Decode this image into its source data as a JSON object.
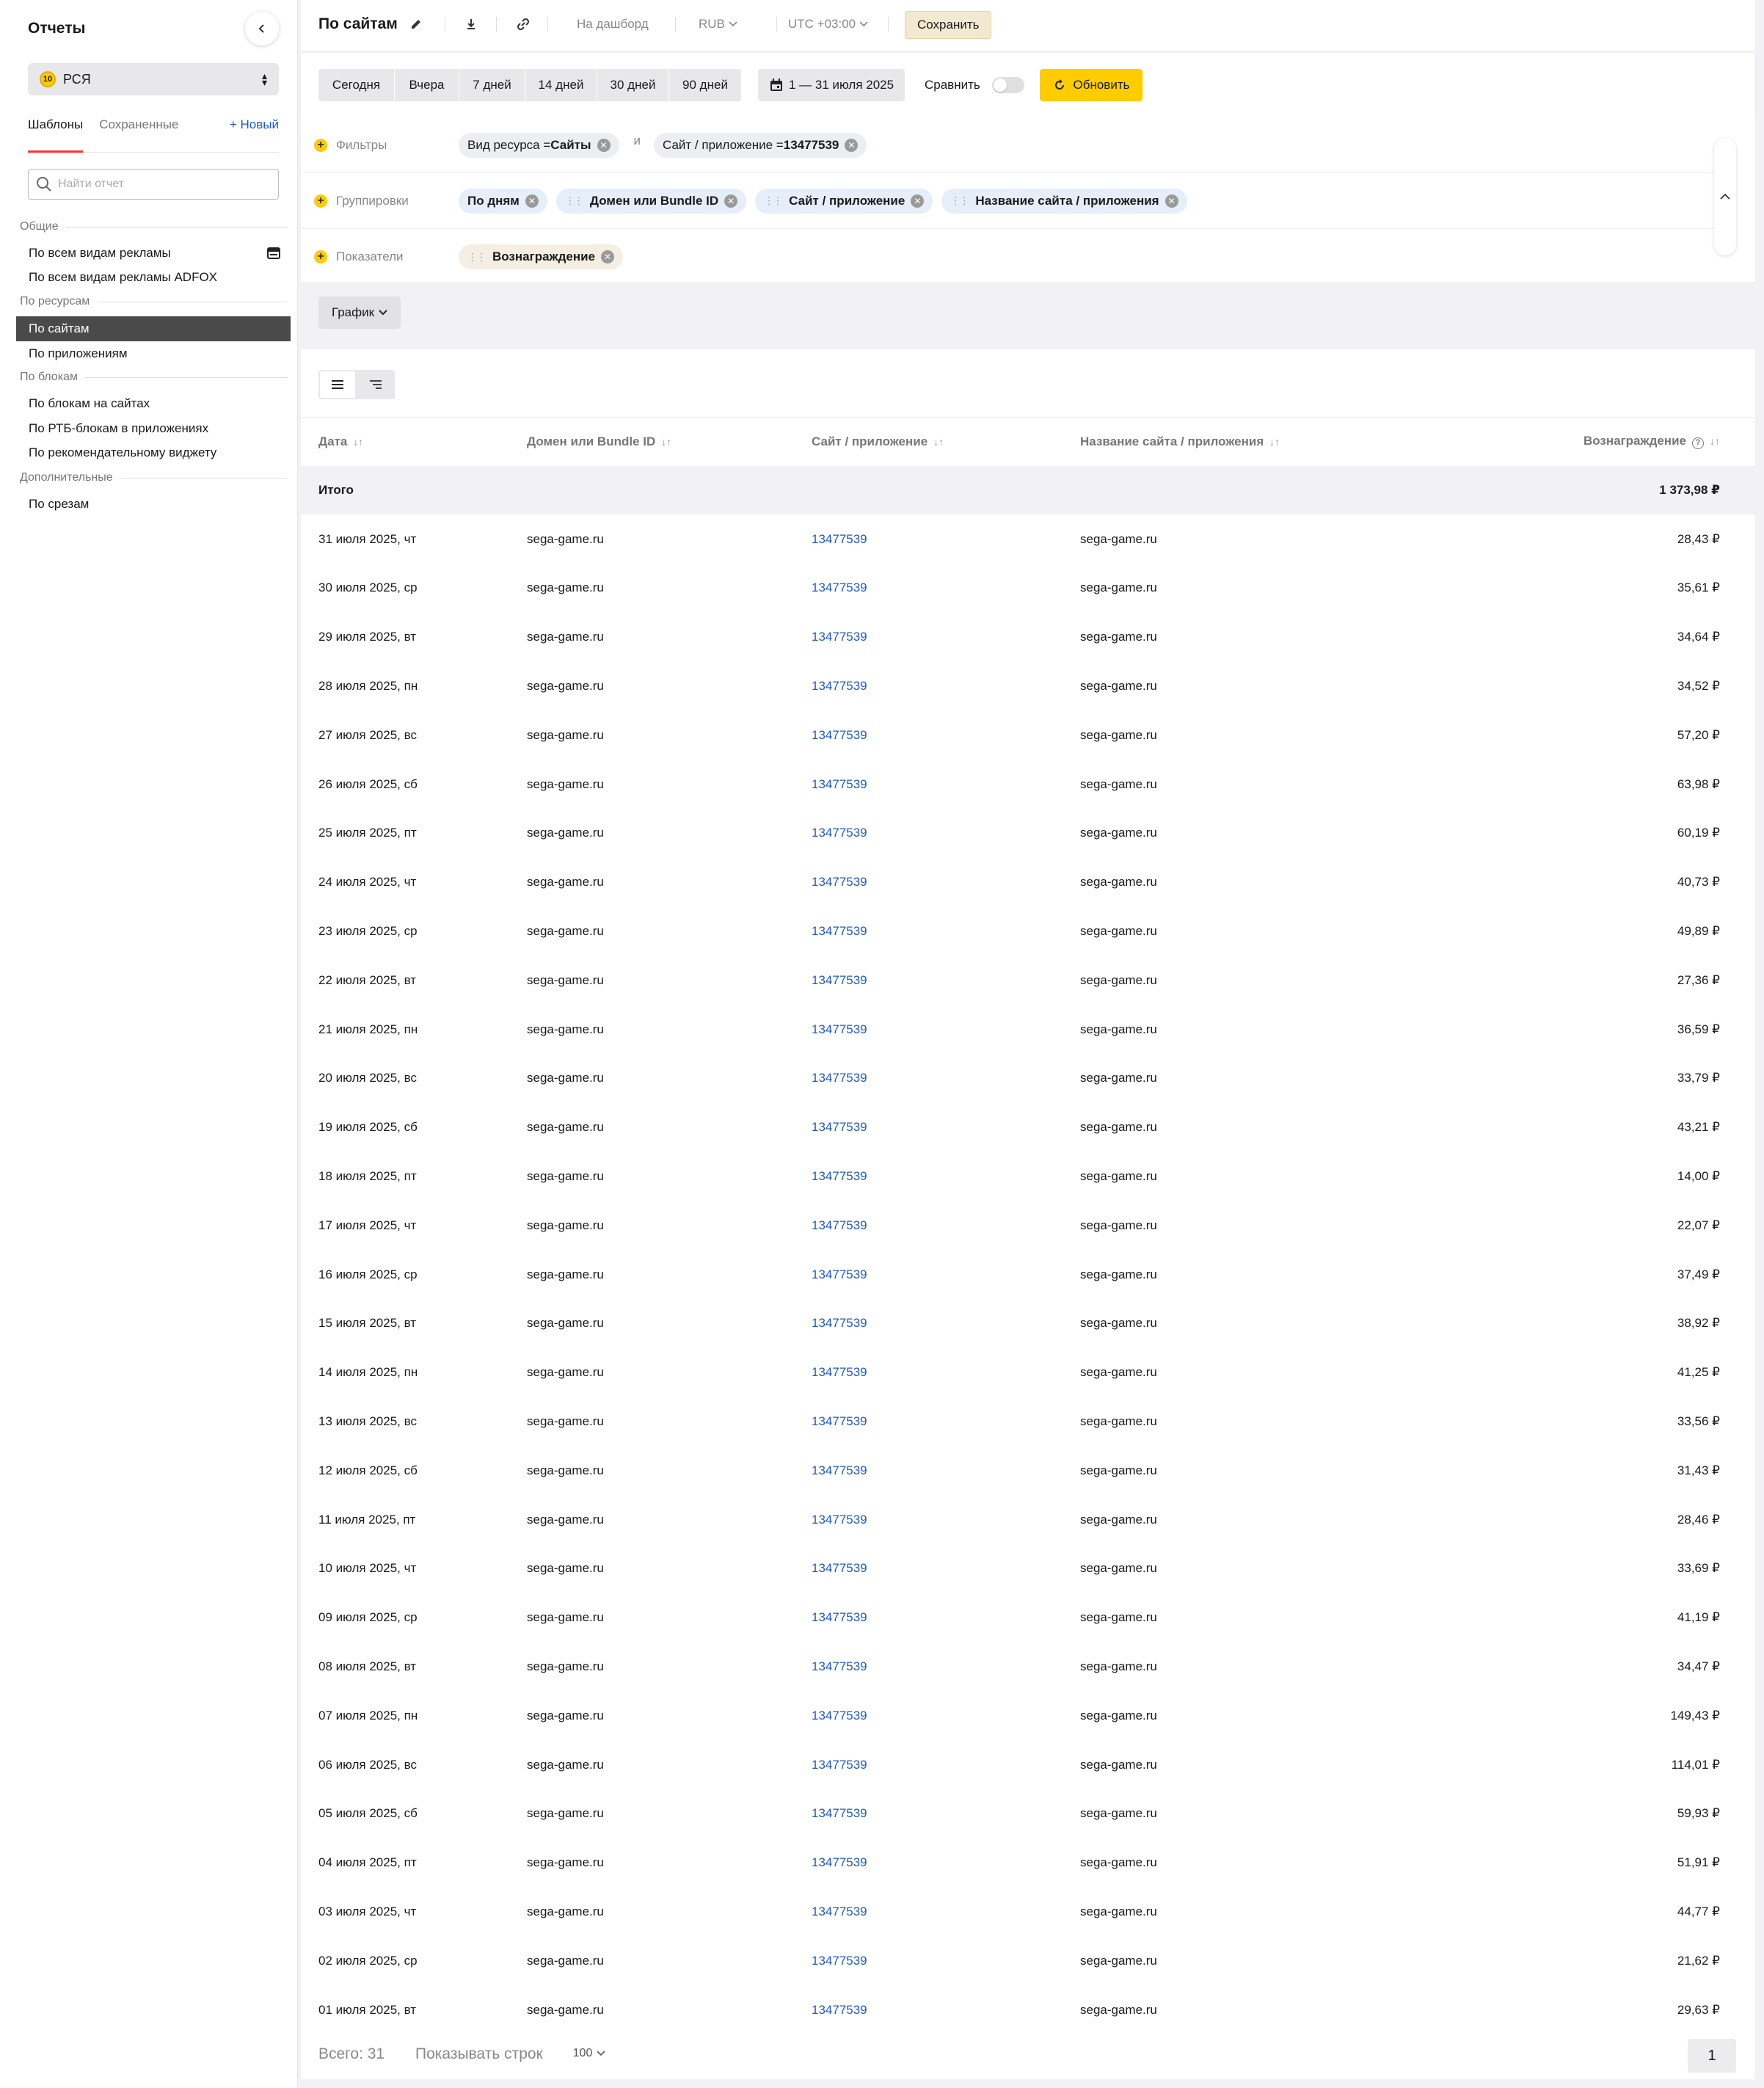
{
  "sidebar": {
    "title": "Отчеты",
    "selector": {
      "coin": "10",
      "value": "РСЯ"
    },
    "tabs": [
      "Шаблоны",
      "Сохраненные"
    ],
    "new_label": "+ Новый",
    "search_placeholder": "Найти отчет",
    "sections": {
      "common": "Общие",
      "resources": "По ресурсам",
      "blocks": "По блокам",
      "extra": "Дополнительные"
    },
    "items": {
      "all_ads": "По всем видам рекламы",
      "all_ads_adfox": "По всем видам рекламы ADFOX",
      "by_sites": "По сайтам",
      "by_apps": "По приложениям",
      "site_blocks": "По блокам на сайтах",
      "rtb_app_blocks": "По РТБ-блокам в приложениях",
      "rec_widget": "По рекомендательному виджету",
      "by_slices": "По срезам"
    }
  },
  "topbar": {
    "title": "По сайтам",
    "dashboard": "На дашборд",
    "currency": "RUB",
    "timezone": "UTC +03:00",
    "save": "Сохранить"
  },
  "periods": [
    "Сегодня",
    "Вчера",
    "7 дней",
    "14 дней",
    "30 дней",
    "90 дней"
  ],
  "date_range": "1 — 31 июля 2025",
  "compare_label": "Сравнить",
  "refresh_label": "Обновить",
  "filters": {
    "label": "Фильтры",
    "and": "и",
    "chip1_prefix": "Вид ресурса = ",
    "chip1_value": "Сайты",
    "chip2_prefix": "Сайт / приложение = ",
    "chip2_value": "13477539"
  },
  "groupings": {
    "label": "Группировки",
    "chips": [
      "По дням",
      "Домен или Bundle ID",
      "Сайт / приложение",
      "Название сайта / приложения"
    ]
  },
  "metrics": {
    "label": "Показатели",
    "chips": [
      "Вознаграждение"
    ]
  },
  "chart_button": "График",
  "table": {
    "headers": [
      "Дата",
      "Домен или Bundle ID",
      "Сайт / приложение",
      "Название сайта / приложения",
      "Вознаграждение"
    ],
    "total_label": "Итого",
    "total_value": "1 373,98 ₽",
    "rows": [
      [
        "31 июля 2025, чт",
        "sega-game.ru",
        "13477539",
        "sega-game.ru",
        "28,43 ₽"
      ],
      [
        "30 июля 2025, ср",
        "sega-game.ru",
        "13477539",
        "sega-game.ru",
        "35,61 ₽"
      ],
      [
        "29 июля 2025, вт",
        "sega-game.ru",
        "13477539",
        "sega-game.ru",
        "34,64 ₽"
      ],
      [
        "28 июля 2025, пн",
        "sega-game.ru",
        "13477539",
        "sega-game.ru",
        "34,52 ₽"
      ],
      [
        "27 июля 2025, вс",
        "sega-game.ru",
        "13477539",
        "sega-game.ru",
        "57,20 ₽"
      ],
      [
        "26 июля 2025, сб",
        "sega-game.ru",
        "13477539",
        "sega-game.ru",
        "63,98 ₽"
      ],
      [
        "25 июля 2025, пт",
        "sega-game.ru",
        "13477539",
        "sega-game.ru",
        "60,19 ₽"
      ],
      [
        "24 июля 2025, чт",
        "sega-game.ru",
        "13477539",
        "sega-game.ru",
        "40,73 ₽"
      ],
      [
        "23 июля 2025, ср",
        "sega-game.ru",
        "13477539",
        "sega-game.ru",
        "49,89 ₽"
      ],
      [
        "22 июля 2025, вт",
        "sega-game.ru",
        "13477539",
        "sega-game.ru",
        "27,36 ₽"
      ],
      [
        "21 июля 2025, пн",
        "sega-game.ru",
        "13477539",
        "sega-game.ru",
        "36,59 ₽"
      ],
      [
        "20 июля 2025, вс",
        "sega-game.ru",
        "13477539",
        "sega-game.ru",
        "33,79 ₽"
      ],
      [
        "19 июля 2025, сб",
        "sega-game.ru",
        "13477539",
        "sega-game.ru",
        "43,21 ₽"
      ],
      [
        "18 июля 2025, пт",
        "sega-game.ru",
        "13477539",
        "sega-game.ru",
        "14,00 ₽"
      ],
      [
        "17 июля 2025, чт",
        "sega-game.ru",
        "13477539",
        "sega-game.ru",
        "22,07 ₽"
      ],
      [
        "16 июля 2025, ср",
        "sega-game.ru",
        "13477539",
        "sega-game.ru",
        "37,49 ₽"
      ],
      [
        "15 июля 2025, вт",
        "sega-game.ru",
        "13477539",
        "sega-game.ru",
        "38,92 ₽"
      ],
      [
        "14 июля 2025, пн",
        "sega-game.ru",
        "13477539",
        "sega-game.ru",
        "41,25 ₽"
      ],
      [
        "13 июля 2025, вс",
        "sega-game.ru",
        "13477539",
        "sega-game.ru",
        "33,56 ₽"
      ],
      [
        "12 июля 2025, сб",
        "sega-game.ru",
        "13477539",
        "sega-game.ru",
        "31,43 ₽"
      ],
      [
        "11 июля 2025, пт",
        "sega-game.ru",
        "13477539",
        "sega-game.ru",
        "28,46 ₽"
      ],
      [
        "10 июля 2025, чт",
        "sega-game.ru",
        "13477539",
        "sega-game.ru",
        "33,69 ₽"
      ],
      [
        "09 июля 2025, ср",
        "sega-game.ru",
        "13477539",
        "sega-game.ru",
        "41,19 ₽"
      ],
      [
        "08 июля 2025, вт",
        "sega-game.ru",
        "13477539",
        "sega-game.ru",
        "34,47 ₽"
      ],
      [
        "07 июля 2025, пн",
        "sega-game.ru",
        "13477539",
        "sega-game.ru",
        "149,43 ₽"
      ],
      [
        "06 июля 2025, вс",
        "sega-game.ru",
        "13477539",
        "sega-game.ru",
        "114,01 ₽"
      ],
      [
        "05 июля 2025, сб",
        "sega-game.ru",
        "13477539",
        "sega-game.ru",
        "59,93 ₽"
      ],
      [
        "04 июля 2025, пт",
        "sega-game.ru",
        "13477539",
        "sega-game.ru",
        "51,91 ₽"
      ],
      [
        "03 июля 2025, чт",
        "sega-game.ru",
        "13477539",
        "sega-game.ru",
        "44,77 ₽"
      ],
      [
        "02 июля 2025, ср",
        "sega-game.ru",
        "13477539",
        "sega-game.ru",
        "21,62 ₽"
      ],
      [
        "01 июля 2025, вт",
        "sega-game.ru",
        "13477539",
        "sega-game.ru",
        "29,63 ₽"
      ]
    ]
  },
  "footer": {
    "total": "Всего: 31",
    "rows_label": "Показывать строк",
    "rows_value": "100",
    "page": "1"
  },
  "colors": {
    "accent": "#ffcc00",
    "link": "#1e5bc6",
    "active_tab": "#ff3333",
    "active_item": "#4a4a4a"
  }
}
